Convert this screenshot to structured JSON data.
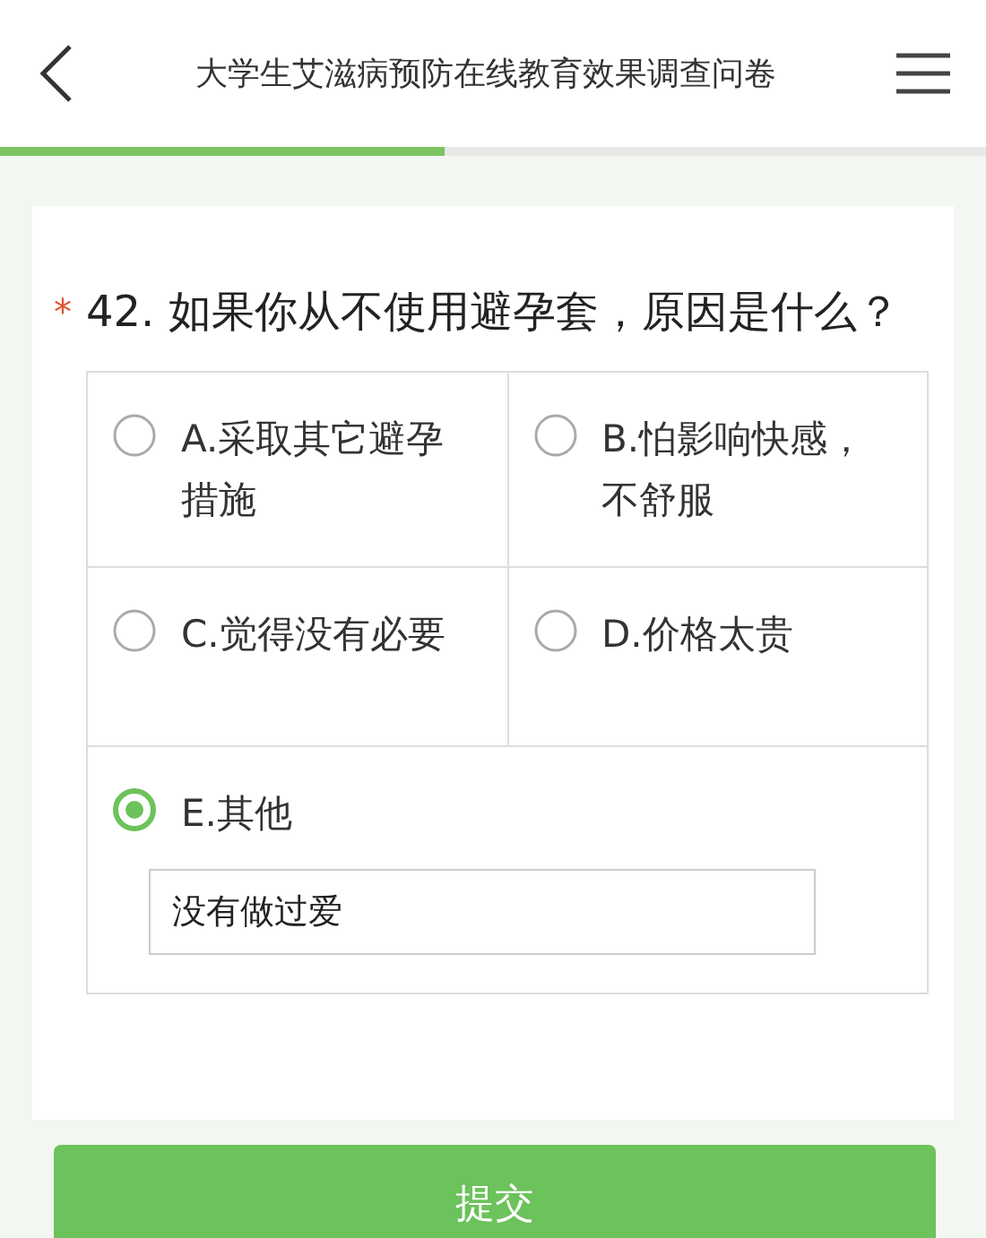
{
  "header": {
    "title": "大学生艾滋病预防在线教育效果调查问卷",
    "progress": {
      "level": 0.45
    }
  },
  "question": {
    "marker": "*",
    "number": "42.",
    "text": "如果你从不使用避孕套，原因是什么？"
  },
  "options": [
    {
      "kind": "choice",
      "label": "A.采取其它避孕措施",
      "selected": false
    },
    {
      "kind": "choice",
      "label": "B.怕影响快感，不舒服",
      "selected": false
    },
    {
      "kind": "choice",
      "label": "C.觉得没有必要",
      "selected": false
    },
    {
      "kind": "choice",
      "label": "D.价格太贵",
      "selected": false
    },
    {
      "kind": "other",
      "label": "E.其他",
      "selected": true,
      "value": "没有做过爱"
    }
  ],
  "submit": "提交"
}
